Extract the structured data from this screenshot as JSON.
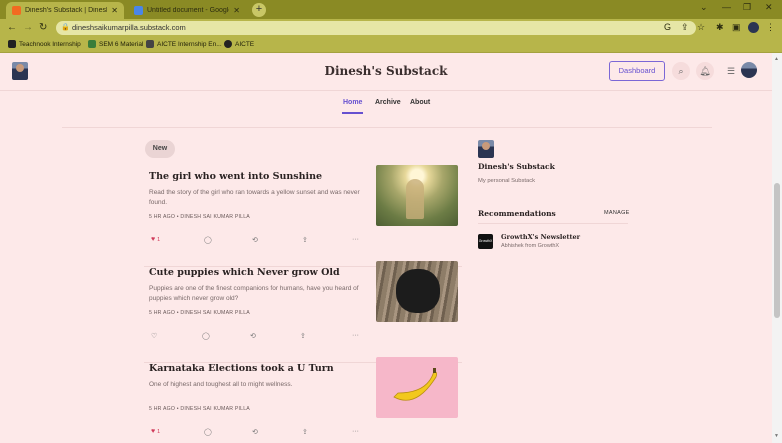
{
  "browser": {
    "tabs": [
      {
        "title": "Dinesh's Substack | Dinesh Sai K",
        "close": "✕",
        "color": "#f26a21"
      },
      {
        "title": "Untitled document - Google Do",
        "close": "✕",
        "color": "#4a86e8"
      }
    ],
    "new_tab": "+",
    "url": "dineshsaikumarpilla.substack.com",
    "bookmarks": [
      {
        "label": "Teachnook Internship",
        "color": "#222222"
      },
      {
        "label": "SEM 6 Material",
        "color": "#3a7d3a"
      },
      {
        "label": "AICTE Internship En...",
        "color": "#444444"
      },
      {
        "label": "AICTE",
        "color": "#222222"
      }
    ]
  },
  "site": {
    "title": "Dinesh's Substack",
    "dashboard_label": "Dashboard",
    "accent_color": "#6650d0",
    "nav": [
      {
        "label": "Home",
        "active": true
      },
      {
        "label": "Archive",
        "active": false
      },
      {
        "label": "About",
        "active": false
      }
    ]
  },
  "feed": {
    "new_label": "New",
    "posts": [
      {
        "title": "The girl who went into Sunshine",
        "subtitle": "Read the story of the girl who ran towards a yellow sunset and was never found.",
        "meta": "5 HR AGO • DINESH SAI KUMAR PILLA",
        "likes": "1",
        "liked": true,
        "thumb": "sunset-field"
      },
      {
        "title": "Cute puppies which Never grow Old",
        "subtitle": "Puppies are one of the finest companions for humans, have you heard of puppies which never grow old?",
        "meta": "5 HR AGO • DINESH SAI KUMAR PILLA",
        "likes": "",
        "liked": false,
        "thumb": "black-puppy"
      },
      {
        "title": "Karnataka Elections took a U Turn",
        "subtitle": "One of highest and toughest all to might wellness.",
        "meta": "5 HR AGO • DINESH SAI KUMAR PILLA",
        "likes": "1",
        "liked": true,
        "thumb": "banana"
      }
    ]
  },
  "sidebar": {
    "title": "Dinesh's Substack",
    "subtitle": "My personal Substack",
    "recommendations_label": "Recommendations",
    "manage_label": "MANAGE",
    "recommendations": [
      {
        "name": "GrowthX's Newsletter",
        "desc": "Abhishek from GrowthX",
        "logo_text": "GrowthX"
      }
    ]
  }
}
